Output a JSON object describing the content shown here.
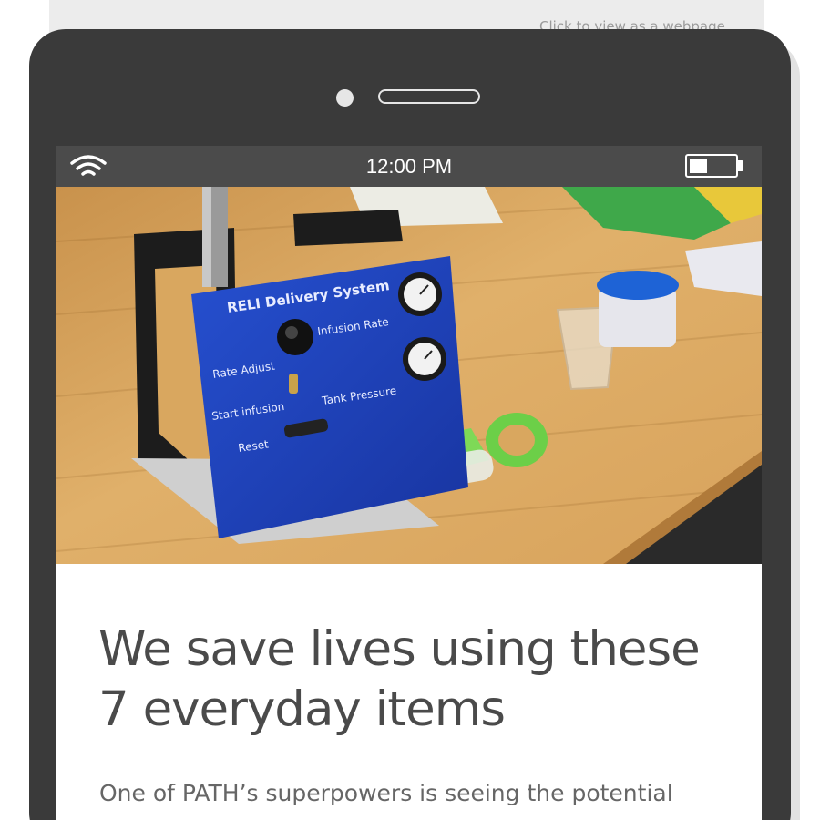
{
  "email": {
    "view_link": "Click to view as a webpage"
  },
  "statusbar": {
    "time": "12:00 PM",
    "battery_level": 0.4,
    "wifi_icon": "wifi-icon",
    "battery_icon": "battery-icon"
  },
  "hero": {
    "panel_title": "RELI Delivery System",
    "labels": {
      "infusion_rate": "Infusion Rate",
      "rate_adjust": "Rate Adjust",
      "start_infusion": "Start infusion",
      "tank_pressure": "Tank Pressure",
      "reset": "Reset"
    },
    "colors": {
      "panel_blue": "#1a3fb0",
      "syringe_green": "#7ed957",
      "wood": "#d9a75f",
      "frame_black": "#1c1c1c"
    }
  },
  "article": {
    "headline": "We save lives using these 7 everyday items",
    "intro": "One of PATH’s superpowers is seeing the potential"
  },
  "colors": {
    "phone_body": "#3a3a3a",
    "statusbar": "#4b4b4b",
    "headline_text": "#4a4a4a",
    "body_text": "#666666"
  }
}
